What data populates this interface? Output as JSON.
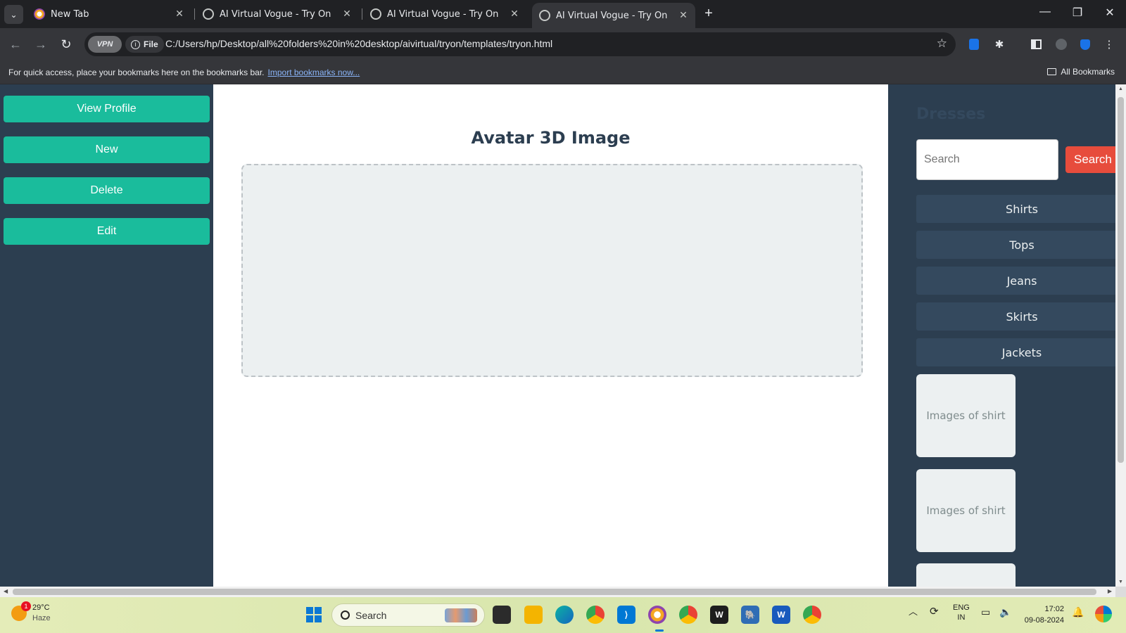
{
  "browser": {
    "tabs": [
      {
        "label": "New Tab",
        "active": false
      },
      {
        "label": "AI Virtual Vogue - Try On",
        "active": false
      },
      {
        "label": "AI Virtual Vogue - Try On",
        "active": false
      },
      {
        "label": "AI Virtual Vogue - Try On",
        "active": true
      }
    ],
    "vpn_label": "VPN",
    "file_label": "File",
    "url": "C:/Users/hp/Desktop/all%20folders%20in%20desktop/aivirtual/tryon/templates/tryon.html",
    "bookmarks_prompt": "For quick access, place your bookmarks here on the bookmarks bar.",
    "import_link": "Import bookmarks now...",
    "all_bookmarks": "All Bookmarks"
  },
  "sidebar": {
    "buttons": [
      {
        "label": "View Profile"
      },
      {
        "label": "New"
      },
      {
        "label": "Delete"
      },
      {
        "label": "Edit"
      }
    ]
  },
  "main": {
    "title": "Avatar 3D Image"
  },
  "dresses": {
    "title": "Dresses",
    "search_placeholder": "Search",
    "search_button": "Search",
    "categories": [
      "Shirts",
      "Tops",
      "Jeans",
      "Skirts",
      "Jackets"
    ],
    "items": [
      "Images of shirt",
      "Images of shirt",
      ""
    ]
  },
  "taskbar": {
    "weather_temp": "29°C",
    "weather_desc": "Haze",
    "weather_badge": "1",
    "search_label": "Search",
    "lang_line1": "ENG",
    "lang_line2": "IN",
    "time": "17:02",
    "date": "09-08-2024"
  },
  "colors": {
    "sidebar_bg": "#2c3e50",
    "accent_button": "#1abc9c",
    "search_button": "#e74c3c",
    "category_bg": "#34495e",
    "placeholder_bg": "#ecf0f1"
  }
}
